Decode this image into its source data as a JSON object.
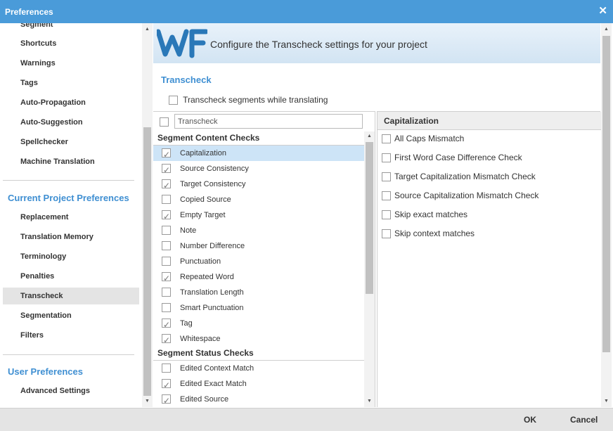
{
  "window": {
    "title": "Preferences",
    "close_glyph": "✕"
  },
  "sidebar": {
    "top_items": [
      {
        "label": "Segment"
      },
      {
        "label": "Shortcuts"
      },
      {
        "label": "Warnings"
      },
      {
        "label": "Tags"
      },
      {
        "label": "Auto-Propagation"
      },
      {
        "label": "Auto-Suggestion"
      },
      {
        "label": "Spellchecker"
      },
      {
        "label": "Machine Translation"
      }
    ],
    "current_project_heading": "Current Project Preferences",
    "project_items": [
      {
        "label": "Replacement"
      },
      {
        "label": "Translation Memory"
      },
      {
        "label": "Terminology"
      },
      {
        "label": "Penalties"
      },
      {
        "label": "Transcheck",
        "active": true
      },
      {
        "label": "Segmentation"
      },
      {
        "label": "Filters"
      }
    ],
    "user_heading": "User Preferences",
    "user_items": [
      {
        "label": "Advanced Settings"
      }
    ]
  },
  "banner": {
    "logo_text": "WF",
    "subtitle": "Configure the Transcheck settings for your project"
  },
  "section_title": "Transcheck",
  "transcheck_option": {
    "label": "Transcheck segments while translating",
    "checked": false
  },
  "filter": {
    "value": "Transcheck"
  },
  "groups": {
    "content": {
      "heading": "Segment Content Checks",
      "items": [
        {
          "label": "Capitalization",
          "checked": true,
          "selected": true
        },
        {
          "label": "Source Consistency",
          "checked": true
        },
        {
          "label": "Target Consistency",
          "checked": true
        },
        {
          "label": "Copied Source",
          "checked": false
        },
        {
          "label": "Empty Target",
          "checked": true
        },
        {
          "label": "Note",
          "checked": false
        },
        {
          "label": "Number Difference",
          "checked": false
        },
        {
          "label": "Punctuation",
          "checked": false
        },
        {
          "label": "Repeated Word",
          "checked": true
        },
        {
          "label": "Translation Length",
          "checked": false
        },
        {
          "label": "Smart Punctuation",
          "checked": false
        },
        {
          "label": "Tag",
          "checked": true
        },
        {
          "label": "Whitespace",
          "checked": true
        }
      ]
    },
    "status": {
      "heading": "Segment Status Checks",
      "items": [
        {
          "label": "Edited Context Match",
          "checked": false
        },
        {
          "label": "Edited Exact Match",
          "checked": true
        },
        {
          "label": "Edited Source",
          "checked": true
        }
      ]
    }
  },
  "detail": {
    "heading": "Capitalization",
    "options": [
      {
        "label": "All Caps Mismatch",
        "checked": false
      },
      {
        "label": "First Word Case Difference Check",
        "checked": false
      },
      {
        "label": "Target Capitalization Mismatch Check",
        "checked": false
      },
      {
        "label": "Source Capitalization Mismatch Check",
        "checked": false
      },
      {
        "label": "Skip exact matches",
        "checked": false
      },
      {
        "label": "Skip context matches",
        "checked": false
      }
    ]
  },
  "footer": {
    "ok_label": "OK",
    "cancel_label": "Cancel"
  },
  "colors": {
    "accent": "#4a9bd9",
    "heading_blue": "#3f8fd2",
    "selected_row": "#cde4f7"
  }
}
